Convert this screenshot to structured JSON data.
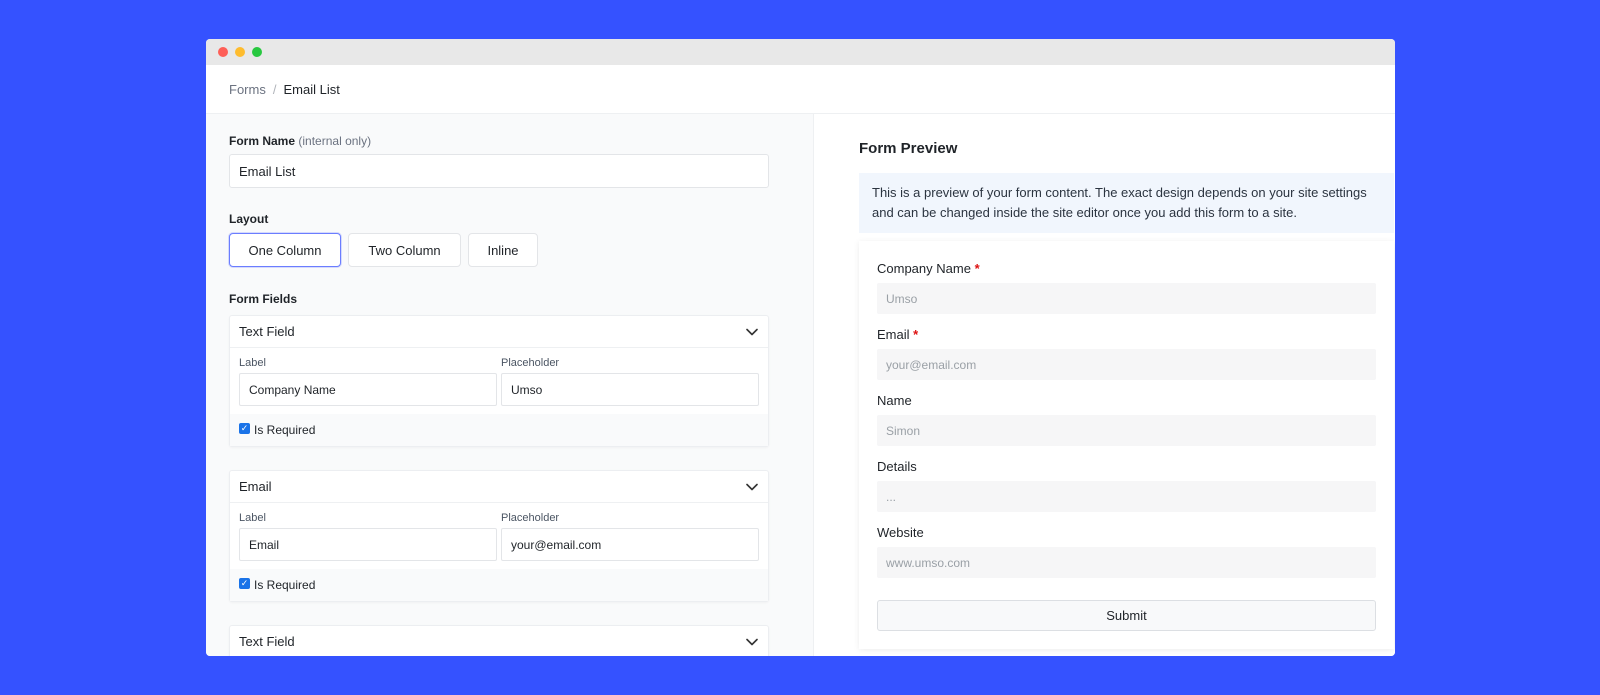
{
  "breadcrumb": {
    "root": "Forms",
    "separator": "/",
    "current": "Email List"
  },
  "form_name": {
    "label": "Form Name",
    "hint": "(internal only)",
    "value": "Email List"
  },
  "layout": {
    "label": "Layout",
    "options": [
      "One Column",
      "Two Column",
      "Inline"
    ],
    "selected": "One Column"
  },
  "form_fields": {
    "label": "Form Fields",
    "items": [
      {
        "type": "Text Field",
        "label_caption": "Label",
        "placeholder_caption": "Placeholder",
        "label": "Company Name",
        "placeholder": "Umso",
        "required_label": "Is Required",
        "required": true
      },
      {
        "type": "Email",
        "label_caption": "Label",
        "placeholder_caption": "Placeholder",
        "label": "Email",
        "placeholder": "your@email.com",
        "required_label": "Is Required",
        "required": true
      },
      {
        "type": "Text Field"
      }
    ]
  },
  "preview": {
    "title": "Form Preview",
    "notice": "This is a preview of your form content. The exact design depends on your site settings and can be changed inside the site editor once you add this form to a site.",
    "required_mark": "*",
    "fields": [
      {
        "label": "Company Name",
        "placeholder": "Umso",
        "required": true
      },
      {
        "label": "Email",
        "placeholder": "your@email.com",
        "required": true
      },
      {
        "label": "Name",
        "placeholder": "Simon",
        "required": false
      },
      {
        "label": "Details",
        "placeholder": "...",
        "required": false
      },
      {
        "label": "Website",
        "placeholder": "www.umso.com",
        "required": false
      }
    ],
    "submit_label": "Submit"
  },
  "colors": {
    "background": "#3552ff",
    "accent": "#6b7dff",
    "checkbox": "#1a73e8",
    "required": "#dd1111"
  },
  "icons": {
    "chevron": "chevron-down-icon",
    "check": "check-icon"
  }
}
